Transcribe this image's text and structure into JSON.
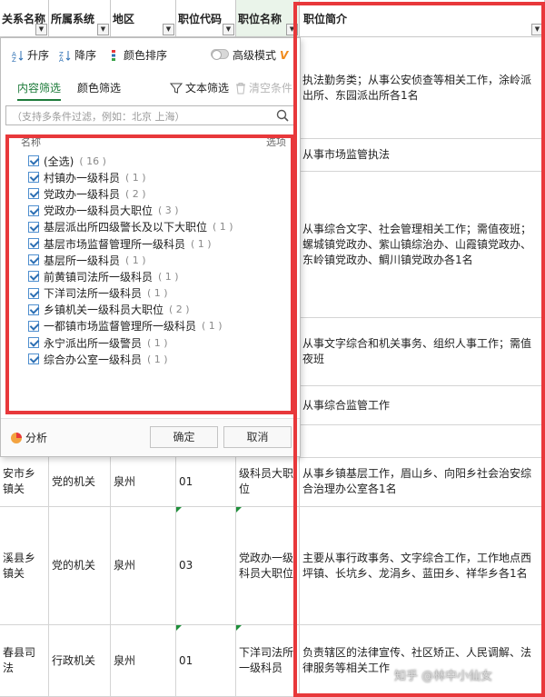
{
  "columns": [
    "关系名称",
    "所属系统",
    "地区",
    "职位代码",
    "职位名称",
    "职位简介"
  ],
  "dropdown_glyph": "▼",
  "colors": {
    "accent_green": "#1d7b3a",
    "highlight_red": "#e8383b",
    "checkbox_blue": "#2d6fb3"
  },
  "filter_panel": {
    "sort_asc": "升序",
    "sort_desc": "降序",
    "color_sort": "颜色排序",
    "advanced_mode": "高级模式",
    "advanced_mark": "V",
    "tab_content": "内容筛选",
    "tab_color": "颜色筛选",
    "text_filter": "文本筛选",
    "clear_conditions": "清空条件",
    "search_placeholder": "（支持多条件过滤，例如：北京 上海）",
    "list_header_left": "名称",
    "list_header_right": "选项",
    "items": [
      {
        "label": "(全选)",
        "count": "( 16 )"
      },
      {
        "label": "村镇办一级科员",
        "count": "( 1 )"
      },
      {
        "label": "党政办一级科员",
        "count": "( 2 )"
      },
      {
        "label": "党政办一级科员大职位",
        "count": "( 3 )"
      },
      {
        "label": "基层派出所四级警长及以下大职位",
        "count": "( 1 )"
      },
      {
        "label": "基层市场监督管理所一级科员",
        "count": "( 1 )"
      },
      {
        "label": "基层所一级科员",
        "count": "( 1 )"
      },
      {
        "label": "前黄镇司法所一级科员",
        "count": "( 1 )"
      },
      {
        "label": "下洋司法所一级科员",
        "count": "( 1 )"
      },
      {
        "label": "乡镇机关一级科员大职位",
        "count": "( 2 )"
      },
      {
        "label": "一都镇市场监督管理所一级科员",
        "count": "( 1 )"
      },
      {
        "label": "永宁派出所一级警员",
        "count": "( 1 )"
      },
      {
        "label": "综合办公室一级科员",
        "count": "( 1 )"
      }
    ],
    "analysis": "分析",
    "ok": "确定",
    "cancel": "取消"
  },
  "rows": [
    {
      "c1": "安市乡镇关",
      "c2": "党的机关",
      "c3": "泉州",
      "c4": "01",
      "c5": "级科员大职位",
      "c6": "从事乡镇基层工作，眉山乡、向阳乡社会治安综合治理办公室各1名"
    },
    {
      "c1": "溪县乡镇关",
      "c2": "党的机关",
      "c3": "泉州",
      "c4": "03",
      "c5": "党政办一级科员大职位",
      "c6": "主要从事行政事务、文字综合工作，工作地点西坪镇、长坑乡、龙涓乡、蓝田乡、祥华乡各1名"
    },
    {
      "c1": "春县司法",
      "c2": "行政机关",
      "c3": "泉州",
      "c4": "01",
      "c5": "下洋司法所一级科员",
      "c6": "负责辖区的法律宣传、社区矫正、人民调解、法律服务等相关工作"
    }
  ],
  "intro_above": [
    "执法勤务类；从事公安侦查等相关工作，涂岭派出所、东园派出所各1名",
    "从事市场监管执法",
    "从事综合文字、社会管理相关工作；需值夜班；螺城镇党政办、紫山镇综治办、山霞镇党政办、东岭镇党政办、鲷川镇党政办各1名",
    "从事文字综合和机关事务、组织人事工作；需值夜班",
    "从事综合监管工作"
  ],
  "watermark": "知乎 @林中小仙女"
}
